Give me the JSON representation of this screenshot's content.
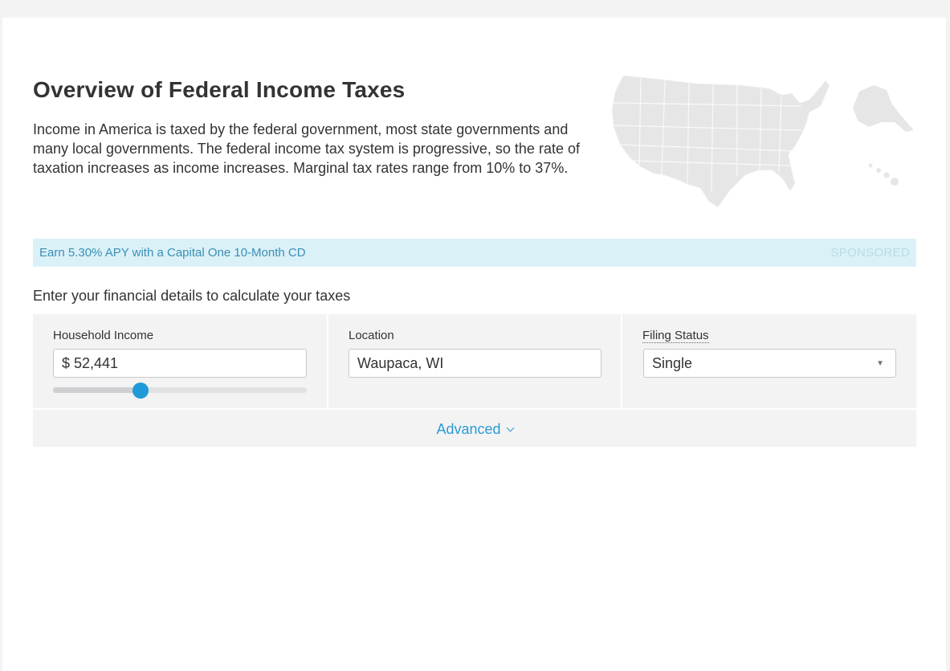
{
  "page": {
    "title": "Overview of Federal Income Taxes",
    "intro": "Income in America is taxed by the federal government, most state governments and many local governments. The federal income tax system is progressive, so the rate of taxation increases as income increases. Marginal tax rates range from 10% to 37%."
  },
  "sponsored": {
    "link": "Earn 5.30% APY with a Capital One 10-Month CD",
    "tag": "SPONSORED"
  },
  "calculator": {
    "prompt": "Enter your financial details to calculate your taxes",
    "income": {
      "label": "Household Income",
      "value": "$ 52,441",
      "slider_fraction": 0.345
    },
    "location": {
      "label": "Location",
      "value": "Waupaca, WI"
    },
    "filing": {
      "label": "Filing Status",
      "value": "Single",
      "caret": "▼"
    },
    "advanced_label": "Advanced"
  },
  "colors": {
    "accent": "#2b9bd4",
    "slider_thumb": "#1f9bd7",
    "sponsor_bg": "#dbf1f8",
    "panel_bg": "#f3f3f4"
  },
  "icons": {
    "map": "us-map-illustration",
    "advanced": "chevron-down-icon",
    "select": "caret-down-icon"
  }
}
